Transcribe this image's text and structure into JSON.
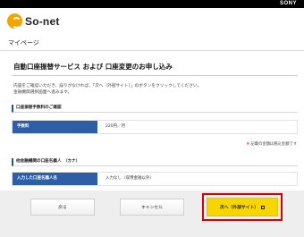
{
  "header": {
    "brand": "SONY",
    "logo_text": "So-net",
    "page_label": "マイページ"
  },
  "main": {
    "title": "自動口座振替サービス および 口座変更のお申し込み",
    "description_line1": "内容をご確認いただき、誤りがなければ、「次へ（外部サイト）」のボタンをクリックしてください。",
    "description_line2": "金融機関選択画面へ進みます。",
    "section_fee": {
      "heading": "口座振替手数料のご確認",
      "label": "手数料",
      "value": "220円／月"
    },
    "note": "記載の金額は税込金額です",
    "note_mark": "※",
    "section_account": {
      "heading": "他金融機関の口座名義人　（カナ）",
      "label": "入力した口座名義人名",
      "value": "入力なし（収用金融以外）"
    }
  },
  "buttons": {
    "back": "戻る",
    "cancel": "キャンセル",
    "next": "次へ（外部サイト）"
  },
  "colors": {
    "accent_blue": "#2d5ea6",
    "next_button_yellow": "#f6d500",
    "highlight_red": "#d50000"
  }
}
